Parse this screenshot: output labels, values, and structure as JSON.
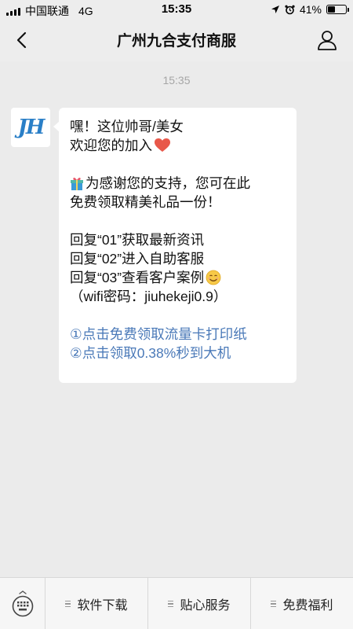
{
  "status_bar": {
    "carrier": "中国联通",
    "network": "4G",
    "time": "15:35",
    "battery": "41%",
    "battery_level": 0.41
  },
  "nav": {
    "title": "广州九合支付商服",
    "back_icon": "chevron-left-icon",
    "user_icon": "person-icon"
  },
  "chat": {
    "timestamp": "15:35",
    "avatar_text": "JH",
    "message": {
      "line1": "嘿！这位帅哥/美女",
      "line2": "欢迎您的加入",
      "line3": "为感谢您的支持，您可在此",
      "line4": "免费领取精美礼品一份！",
      "line5": "回复“01”获取最新资讯",
      "line6": "回复“02”进入自助客服",
      "line7": "回复“03”查看客户案例",
      "line8": "（wifi密码：jiuhekeji0.9）",
      "link1": "①点击免费领取流量卡打印纸",
      "link2": "②点击领取0.38%秒到大机"
    },
    "link_color": "#4a79b8"
  },
  "bottom_menu": {
    "keyboard_icon": "keyboard-icon",
    "items": [
      {
        "label": "软件下载"
      },
      {
        "label": "贴心服务"
      },
      {
        "label": "免费福利"
      }
    ]
  }
}
